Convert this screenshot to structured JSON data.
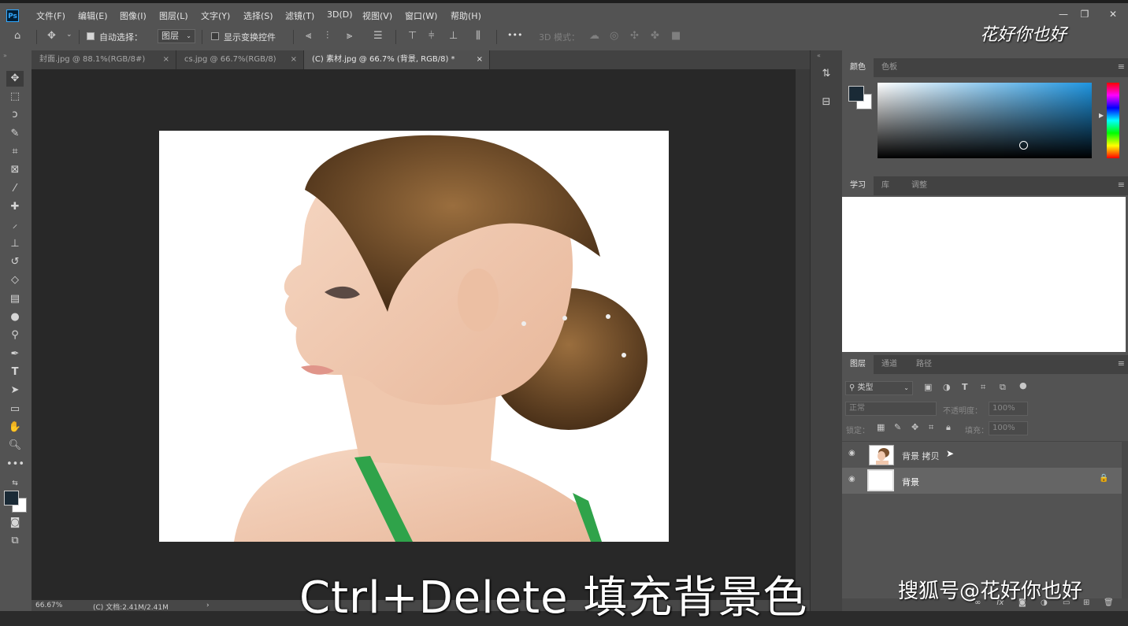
{
  "app": {
    "logo": "Ps"
  },
  "menu": [
    "文件(F)",
    "编辑(E)",
    "图像(I)",
    "图层(L)",
    "文字(Y)",
    "选择(S)",
    "滤镜(T)",
    "3D(D)",
    "视图(V)",
    "窗口(W)",
    "帮助(H)"
  ],
  "window_controls": {
    "minimize": "—",
    "restore": "❐",
    "close": "✕"
  },
  "options": {
    "auto_select_label": "自动选择：",
    "auto_select_target": "图层",
    "show_transform_label": "显示变换控件",
    "more": "•••",
    "mode_3d_label": "3D 模式："
  },
  "tabs": [
    {
      "label": "封面.jpg @ 88.1%(RGB/8#)",
      "close": "×"
    },
    {
      "label": "cs.jpg @ 66.7%(RGB/8)",
      "close": "×"
    },
    {
      "label": "(C) 素材.jpg @ 66.7% (背景, RGB/8) *",
      "close": "×"
    }
  ],
  "status": {
    "zoom": "66.67%",
    "doc": "(C) 文档:2.41M/2.41M",
    "arrow": "›"
  },
  "panels": {
    "color_tabs": [
      "颜色",
      "色板"
    ],
    "learn_tabs": [
      "学习",
      "库",
      "调整"
    ],
    "layers_tabs": [
      "图层",
      "通道",
      "路径"
    ],
    "menu_icon": "≡"
  },
  "layers_panel": {
    "filter_kind": "类型",
    "blend_mode": "正常",
    "opacity_label": "不透明度：",
    "opacity_value": "100%",
    "lock_label": "锁定：",
    "fill_label": "填充：",
    "fill_value": "100%",
    "layers": [
      {
        "name": "背景 拷贝",
        "visible": "👁",
        "selected": false
      },
      {
        "name": "背景",
        "visible": "👁",
        "selected": true,
        "lock": "🔒"
      }
    ]
  },
  "colors": {
    "foreground": "#1a2a36",
    "background": "#ffffff",
    "accent": "#31a8ff"
  },
  "caption": "Ctrl+Delete 填充背景色",
  "watermark": "搜狐号@花好你也好",
  "brand_logo": "花好你也好"
}
